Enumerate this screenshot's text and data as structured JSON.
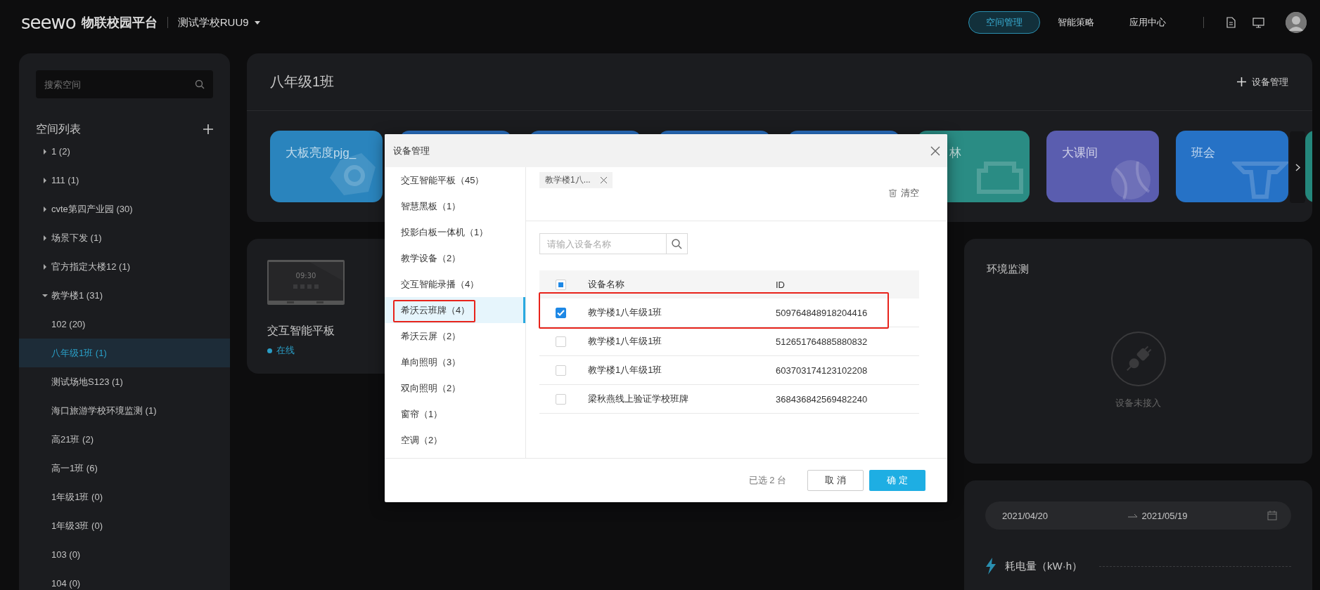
{
  "topbar": {
    "logo": "seewo",
    "platform": "物联校园平台",
    "school": "测试学校RUU9",
    "nav": [
      {
        "label": "空间管理",
        "selected": true
      },
      {
        "label": "智能策略",
        "selected": false
      },
      {
        "label": "应用中心",
        "selected": false
      }
    ]
  },
  "sidebar": {
    "search_placeholder": "搜索空间",
    "title": "空间列表",
    "tree": [
      {
        "label": "1 (2)",
        "expanded": false
      },
      {
        "label": "111 (1)",
        "expanded": false
      },
      {
        "label": "cvte第四产业园 (30)",
        "expanded": false
      },
      {
        "label": "场景下发 (1)",
        "expanded": false
      },
      {
        "label": "官方指定大楼12 (1)",
        "expanded": false
      },
      {
        "label": "教学楼1 (31)",
        "expanded": true,
        "children": [
          {
            "label": "102 (20)",
            "selected": false
          },
          {
            "label": "八年级1班 (1)",
            "selected": true
          },
          {
            "label": "测试场地S123 (1)",
            "selected": false
          },
          {
            "label": "海口旅游学校环境监测 (1)",
            "selected": false
          },
          {
            "label": "高21班 (2)",
            "selected": false
          },
          {
            "label": "高一1班 (6)",
            "selected": false
          },
          {
            "label": "1年级1班 (0)",
            "selected": false
          },
          {
            "label": "1年级3班 (0)",
            "selected": false
          },
          {
            "label": "103 (0)",
            "selected": false
          },
          {
            "label": "104 (0)",
            "selected": false
          }
        ]
      }
    ]
  },
  "space": {
    "title": "八年级1班",
    "action": "设备管理",
    "scenes": [
      {
        "label": "大板亮度pjg_",
        "color": "#2a84bd"
      },
      {
        "label": "林",
        "color": "#2a8c84",
        "partially_hidden": true
      },
      {
        "label": "大课间",
        "color": "#5a5daf"
      },
      {
        "label": "班会",
        "color": "#2672c6"
      },
      {
        "color": "#24877c"
      }
    ]
  },
  "device": {
    "screen_time": "09:30",
    "name": "交互智能平板",
    "status": "在线",
    "online": true
  },
  "environment": {
    "title": "环境监测",
    "empty_text": "设备未接入"
  },
  "energy": {
    "start_date": "2021/04/20",
    "end_date": "2021/05/19",
    "title": "耗电量（kW·h）"
  },
  "modal": {
    "title": "设备管理",
    "categories": [
      {
        "label": "交互智能平板（45）",
        "selected": false,
        "highlighted": false
      },
      {
        "label": "智慧黑板（1）",
        "selected": false,
        "highlighted": false
      },
      {
        "label": "投影白板一体机（1）",
        "selected": false,
        "highlighted": false
      },
      {
        "label": "教学设备（2）",
        "selected": false,
        "highlighted": false
      },
      {
        "label": "交互智能录播（4）",
        "selected": false,
        "highlighted": false
      },
      {
        "label": "希沃云班牌（4）",
        "selected": true,
        "highlighted": true
      },
      {
        "label": "希沃云屏（2）",
        "selected": false,
        "highlighted": false
      },
      {
        "label": "单向照明（3）",
        "selected": false,
        "highlighted": false
      },
      {
        "label": "双向照明（2）",
        "selected": false,
        "highlighted": false
      },
      {
        "label": "窗帘（1）",
        "selected": false,
        "highlighted": false
      },
      {
        "label": "空调（2）",
        "selected": false,
        "highlighted": false
      }
    ],
    "tags": [
      "教学楼1八..."
    ],
    "clear": "清空",
    "search_placeholder": "请输入设备名称",
    "columns": [
      "设备名称",
      "ID"
    ],
    "select_all": {
      "partial": true
    },
    "rows": [
      {
        "name": "教学楼1八年级1班",
        "id": "509764848918204416",
        "checked": true,
        "highlighted": true
      },
      {
        "name": "教学楼1八年级1班",
        "id": "512651764885880832",
        "checked": false,
        "highlighted": false
      },
      {
        "name": "教学楼1八年级1班",
        "id": "603703174123102208",
        "checked": false,
        "highlighted": false
      },
      {
        "name": "梁秋燕线上验证学校班牌",
        "id": "368436842569482240",
        "checked": false,
        "highlighted": false
      }
    ],
    "selected_count": "已选 2 台",
    "cancel": "取 消",
    "ok": "确 定"
  }
}
